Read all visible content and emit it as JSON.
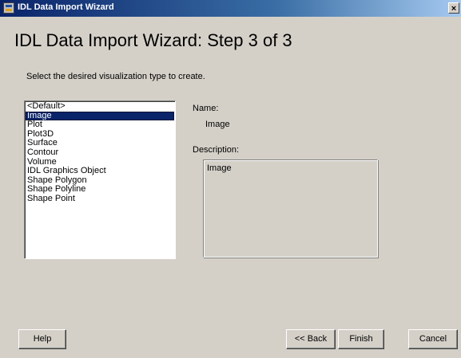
{
  "window": {
    "title": "IDL Data Import Wizard",
    "close_glyph": "×",
    "icon": "idl-app-icon"
  },
  "heading": "IDL Data Import Wizard: Step 3 of 3",
  "instruction": "Select the desired visualization type to create.",
  "types": {
    "selected_index": 1,
    "items": [
      "<Default>",
      "Image",
      "Plot",
      "Plot3D",
      "Surface",
      "Contour",
      "Volume",
      "IDL Graphics Object",
      "Shape Polygon",
      "Shape Polyline",
      "Shape Point"
    ]
  },
  "details": {
    "name_label": "Name:",
    "name_value": "Image",
    "description_label": "Description:",
    "description_value": "Image"
  },
  "buttons": {
    "help": "Help",
    "back": "<< Back",
    "finish": "Finish",
    "cancel": "Cancel"
  },
  "colors": {
    "titlebar_start": "#0a246a",
    "selection": "#0a246a",
    "dialog_face": "#d4d0c8"
  }
}
